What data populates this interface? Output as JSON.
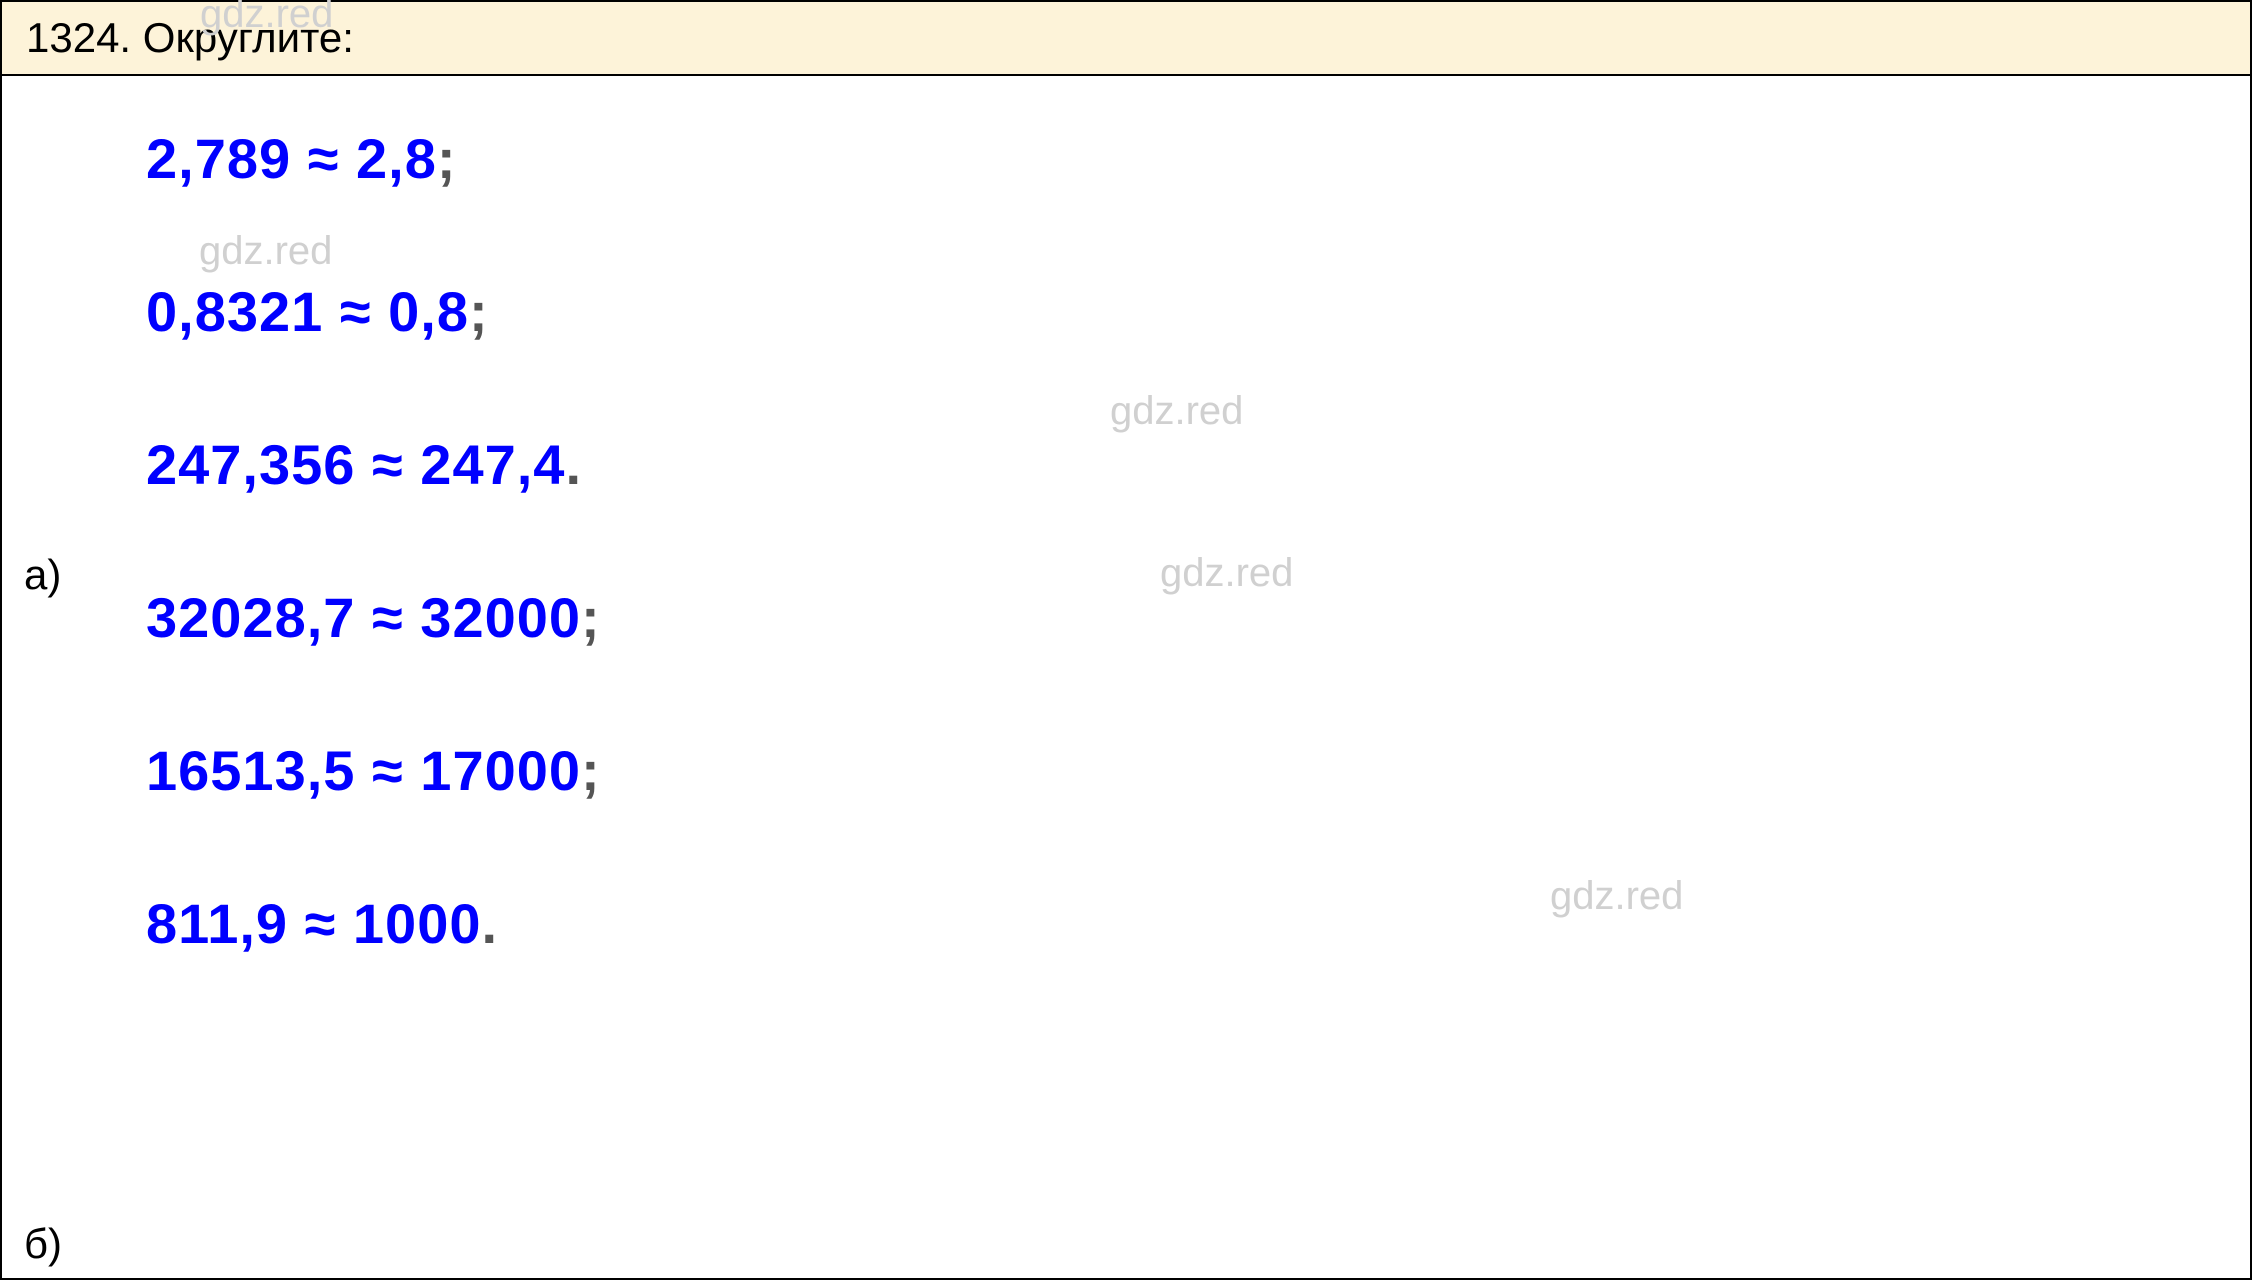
{
  "header": {
    "problem_number": "1324.",
    "problem_instruction": "Округлите:"
  },
  "parts": {
    "a_label": "а)",
    "b_label": "б)"
  },
  "solutions": {
    "line1_src": "2,789",
    "line1_approx": "≈",
    "line1_res": "2,8",
    "line1_punct": ";",
    "line2_src": "0,8321",
    "line2_approx": "≈",
    "line2_res": "0,8",
    "line2_punct": ";",
    "line3_src": "247,356",
    "line3_approx": "≈",
    "line3_res": "247,4",
    "line3_punct": ".",
    "line4_src": "32028,7",
    "line4_approx": "≈",
    "line4_res": "32000",
    "line4_punct": ";",
    "line5_src": "16513,5",
    "line5_approx": "≈",
    "line5_res": "17000",
    "line5_punct": ";",
    "line6_src": "811,9",
    "line6_approx": "≈",
    "line6_res": "1000",
    "line6_punct": "."
  },
  "watermark": "gdz.red"
}
